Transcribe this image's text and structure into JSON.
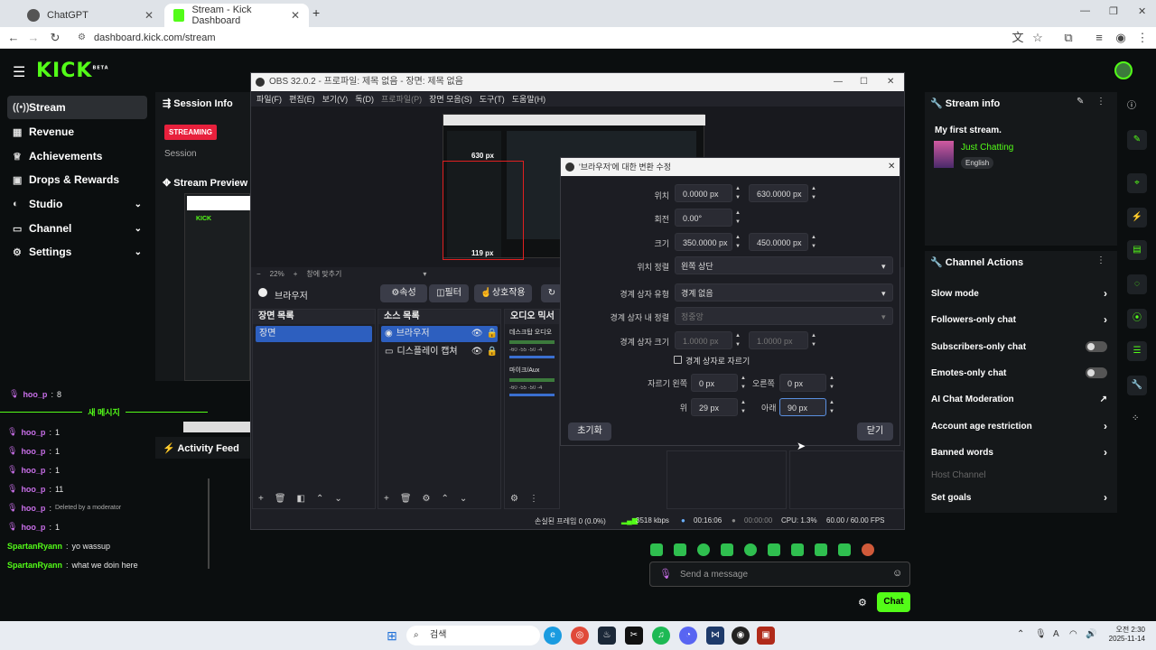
{
  "browser": {
    "tabs": [
      {
        "label": "ChatGPT"
      },
      {
        "label": "Stream - Kick Dashboard"
      }
    ],
    "new_tab": "+",
    "url": "dashboard.kick.com/stream"
  },
  "kick": {
    "logo": "KICK",
    "logo_sup": "BETA",
    "nav": [
      {
        "label": "Stream",
        "icon": "broadcast-icon"
      },
      {
        "label": "Revenue",
        "icon": "bank-icon"
      },
      {
        "label": "Achievements",
        "icon": "trophy-icon"
      },
      {
        "label": "Drops & Rewards",
        "icon": "gift-icon"
      },
      {
        "label": "Studio",
        "icon": "palette-icon"
      },
      {
        "label": "Channel",
        "icon": "channel-icon"
      },
      {
        "label": "Settings",
        "icon": "gear-icon"
      }
    ],
    "session_info": {
      "title": "Session Info",
      "badge": "STREAMING",
      "label": "Session"
    },
    "stream_preview": {
      "title": "Stream Preview"
    },
    "activity_feed": {
      "title": "Activity Feed"
    },
    "new_messages": "새 메시지",
    "chat_top": {
      "user": "hoo_p",
      "text": "8"
    },
    "chat": [
      {
        "user": "hoo_p",
        "text": "1",
        "type": "u"
      },
      {
        "user": "hoo_p",
        "text": "1",
        "type": "u"
      },
      {
        "user": "hoo_p",
        "text": "1",
        "type": "u"
      },
      {
        "user": "hoo_p",
        "text": "11",
        "type": "u"
      },
      {
        "user": "hoo_p",
        "text": "Deleted by a moderator",
        "type": "u"
      },
      {
        "user": "hoo_p",
        "text": "1",
        "type": "u"
      },
      {
        "user": "SpartanRyann",
        "text": "yo wassup",
        "type": "g"
      },
      {
        "user": "SpartanRyann",
        "text": "what we doin here",
        "type": "g"
      }
    ],
    "stream_info": {
      "title": "Stream info",
      "stream_title": "My first stream.",
      "category": "Just Chatting",
      "language": "English"
    },
    "channel_actions": {
      "title": "Channel Actions",
      "items": [
        {
          "label": "Slow mode",
          "kind": "chevron"
        },
        {
          "label": "Followers-only chat",
          "kind": "chevron"
        },
        {
          "label": "Subscribers-only chat",
          "kind": "toggle"
        },
        {
          "label": "Emotes-only chat",
          "kind": "toggle"
        },
        {
          "label": "AI Chat Moderation",
          "kind": "external"
        },
        {
          "label": "Account age restriction",
          "kind": "chevron"
        },
        {
          "label": "Banned words",
          "kind": "chevron"
        },
        {
          "label": "Host Channel",
          "kind": "disabled"
        },
        {
          "label": "Set goals",
          "kind": "chevron"
        }
      ]
    },
    "chat_input": {
      "placeholder": "Send a message",
      "send": "Chat"
    }
  },
  "obs": {
    "title": "OBS 32.0.2 - 프로파일: 제목 없음 - 장면: 제목 없음",
    "menu": [
      "파일(F)",
      "편집(E)",
      "보기(V)",
      "독(D)",
      "프로파일(P)",
      "장면 모음(S)",
      "도구(T)",
      "도움말(H)"
    ],
    "preview_labels": {
      "top": "630 px",
      "bottom": "119 px"
    },
    "zoom": "22%",
    "zoom_fit": "창에 맞추기",
    "source_bar": {
      "name": "브라우저",
      "props": "속성",
      "filters": "필터",
      "interact": "상호작용"
    },
    "scenes": {
      "title": "장면 목록",
      "items": [
        "장면"
      ]
    },
    "sources": {
      "title": "소스 목록",
      "items": [
        "브라우저",
        "디스플레이 캡쳐"
      ]
    },
    "mixer": {
      "title": "오디오 믹서",
      "tracks": [
        "데스크탑 오디오",
        "마이크/Aux"
      ],
      "scale": "-60 -55 -50 -4"
    },
    "status": {
      "dropped": "손실된 프레임 0 (0.0%)",
      "bitrate": "3518 kbps",
      "live": "00:16:06",
      "rec": "00:00:00",
      "cpu": "CPU: 1.3%",
      "fps": "60.00 / 60.00 FPS"
    }
  },
  "dialog": {
    "title": "'브라우저'에 대한 변환 수정",
    "position_label": "위치",
    "pos_x": "0.0000 px",
    "pos_y": "630.0000 px",
    "rotation_label": "회전",
    "rotation": "0.00°",
    "size_label": "크기",
    "size_w": "350.0000 px",
    "size_h": "450.0000 px",
    "align_label": "위치 정렬",
    "align": "왼쪽 상단",
    "bbox_type_label": "경계 상자 유형",
    "bbox_type": "경계 없음",
    "bbox_align_label": "경계 상자 내 정렬",
    "bbox_align": "정중앙",
    "bbox_size_label": "경계 상자 크기",
    "bbox_w": "1.0000 px",
    "bbox_h": "1.0000 px",
    "crop_to_bbox": "경계 상자로 자르기",
    "crop_left_label": "자르기 왼쪽",
    "crop_left": "0 px",
    "crop_right_label": "오른쪽",
    "crop_right": "0 px",
    "crop_top_label": "위",
    "crop_top": "29 px",
    "crop_bottom_label": "아래",
    "crop_bottom": "90 px",
    "reset": "초기화",
    "close": "닫기"
  },
  "taskbar": {
    "search": "검색",
    "time": "오전 2:30",
    "date": "2025-11-14"
  }
}
